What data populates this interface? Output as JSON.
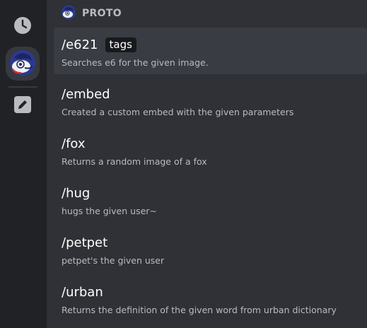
{
  "sidebar": {
    "items": [
      {
        "icon": "clock-icon"
      },
      {
        "icon": "bot-avatar"
      },
      {
        "icon": "pencil-icon"
      }
    ]
  },
  "header": {
    "title": "PROTO",
    "avatar": "bot-avatar"
  },
  "commands": [
    {
      "name": "/e621",
      "option": "tags",
      "description": "Searches e6 for the given image."
    },
    {
      "name": "/embed",
      "description": "Created a custom embed with the given parameters"
    },
    {
      "name": "/fox",
      "description": "Returns a random image of a fox"
    },
    {
      "name": "/hug",
      "description": "hugs the given user~"
    },
    {
      "name": "/petpet",
      "description": "petpet's the given user"
    },
    {
      "name": "/urban",
      "description": "Returns the definition of the given word from urban dictionary"
    }
  ],
  "colors": {
    "background": "#2f3136",
    "rail": "#202225",
    "selected": "#393c43",
    "text": "#ffffff",
    "muted": "#b9bbbe"
  }
}
